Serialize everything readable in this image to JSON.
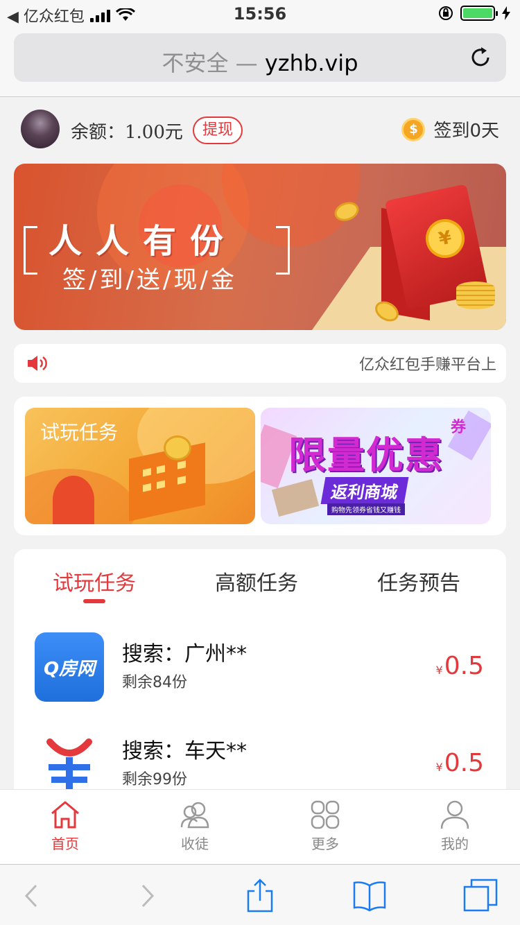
{
  "status_bar": {
    "back_app": "◀ 亿众红包",
    "time": "15:56"
  },
  "browser": {
    "insecure_label": "不安全 —",
    "domain": "yzhb.vip"
  },
  "user": {
    "balance_label": "余额：1.00元",
    "withdraw_label": "提现",
    "checkin_label": "签到0天",
    "coin_symbol": "$"
  },
  "banner": {
    "title": "人人有份",
    "subtitle": "签/到/送/现/金",
    "coin_symbol": "¥"
  },
  "notice": {
    "text": "亿众红包手赚平台上"
  },
  "promos": {
    "left_label": "试玩任务",
    "right_big": "限量优惠",
    "right_corner": "券",
    "right_mall": "返利商城",
    "right_small": "购物先领券省钱又赚钱"
  },
  "tasks": {
    "tabs": [
      {
        "label": "试玩任务",
        "active": true
      },
      {
        "label": "高额任务",
        "active": false
      },
      {
        "label": "任务预告",
        "active": false
      }
    ],
    "items": [
      {
        "icon": "qfang-app-icon",
        "icon_text": "Q房网",
        "title": "搜索：广州**",
        "remain": "剩余84份",
        "currency": "¥",
        "price": "0.5"
      },
      {
        "icon": "yang-app-icon",
        "title": "搜索：车天**",
        "remain": "剩余99份",
        "currency": "¥",
        "price": "0.5"
      }
    ]
  },
  "tabbar": {
    "items": [
      {
        "label": "首页",
        "icon": "home-icon",
        "active": true
      },
      {
        "label": "收徒",
        "icon": "users-icon",
        "active": false
      },
      {
        "label": "更多",
        "icon": "grid-icon",
        "active": false
      },
      {
        "label": "我的",
        "icon": "person-icon",
        "active": false
      }
    ]
  },
  "colors": {
    "accent": "#e4393c",
    "banner": "#d9532e",
    "qfang": "#2f7fe8",
    "coin": "#f5a623"
  }
}
